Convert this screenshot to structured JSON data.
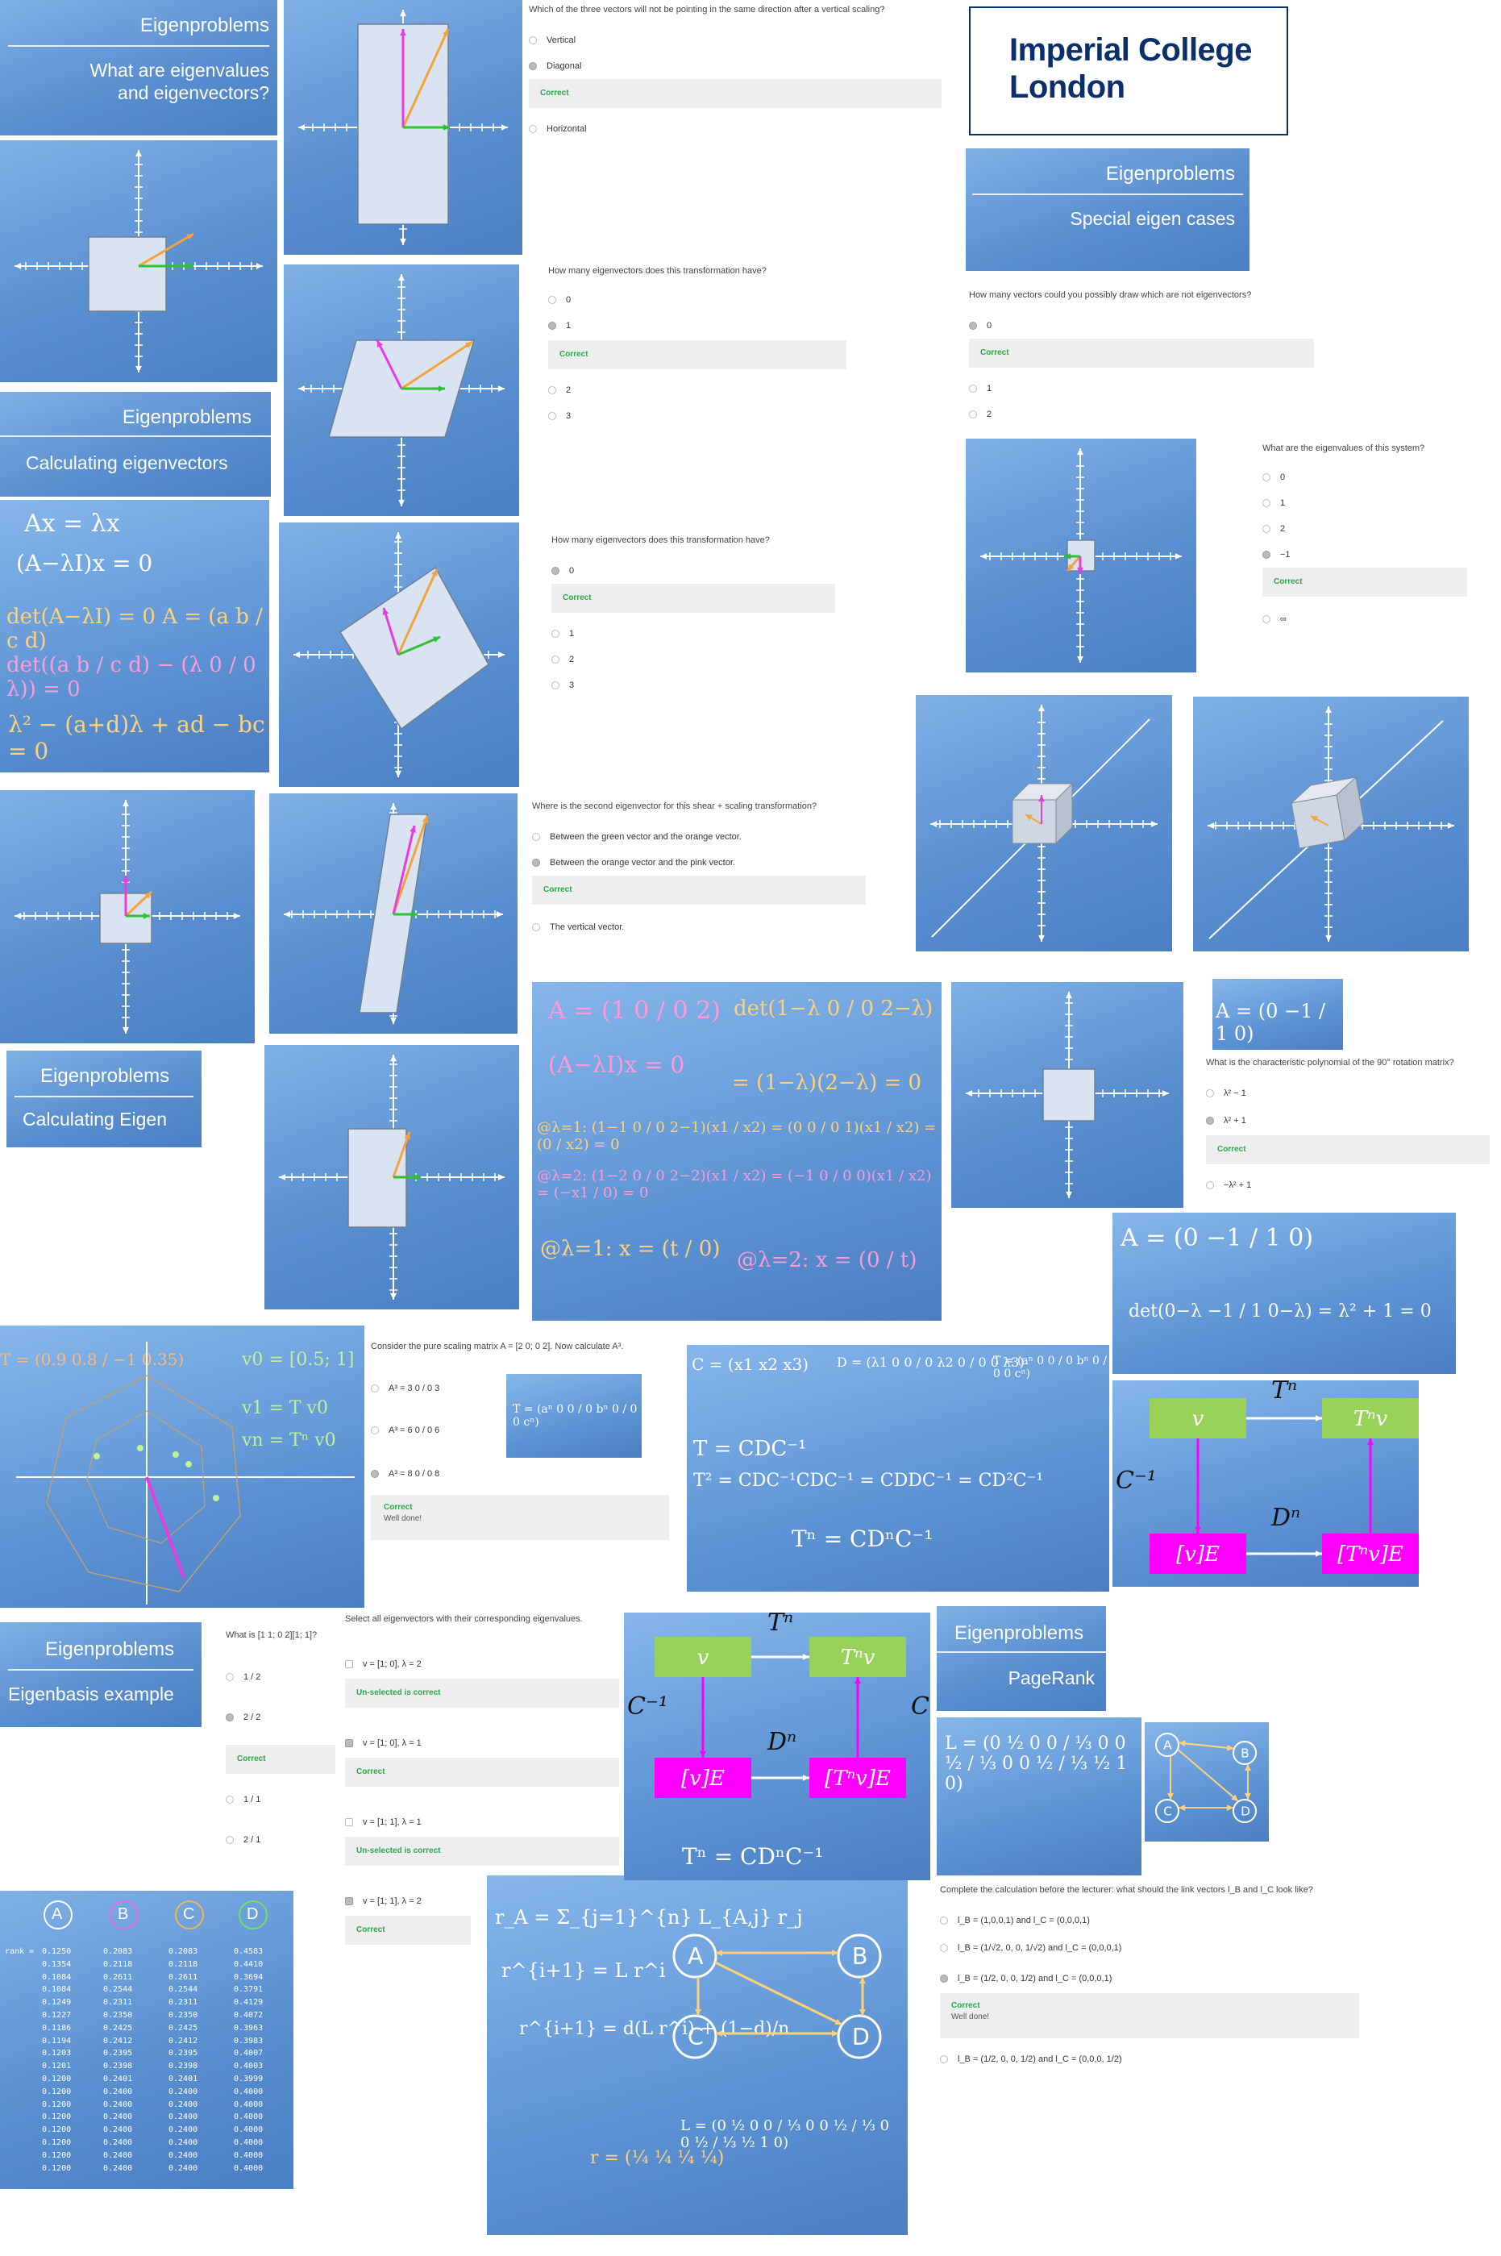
{
  "logo": {
    "line1": "Imperial College",
    "line2": "London"
  },
  "title_cards": [
    {
      "heading": "Eigenproblems",
      "subtitle_line1": "What are eigenvalues",
      "subtitle_line2": "and eigenvectors?"
    },
    {
      "heading": "Eigenproblems",
      "subtitle_line1": "Calculating eigenvectors"
    },
    {
      "heading": "Eigenproblems",
      "subtitle_line1": "Calculating Eigen"
    },
    {
      "heading": "Eigenproblems",
      "subtitle_line1": "Eigenbasis example"
    },
    {
      "heading": "Eigenproblems",
      "subtitle_line1": "Special eigen cases"
    },
    {
      "heading": "Eigenproblems",
      "subtitle_line1": "PageRank"
    }
  ],
  "quizzes": {
    "q1": {
      "question": "Which of the three vectors will not be pointing in the same direction after a vertical scaling?",
      "options": [
        "Vertical",
        "Diagonal",
        "Horizontal"
      ],
      "feedback": "Correct"
    },
    "q2": {
      "question": "How many eigenvectors does this transformation have?",
      "options": [
        "0",
        "1",
        "2",
        "3"
      ],
      "feedback": "Correct"
    },
    "q3": {
      "question": "How many eigenvectors does this transformation have?",
      "options": [
        "0",
        "1",
        "2",
        "3"
      ],
      "feedback": "Correct"
    },
    "q4": {
      "question": "Where is the second eigenvector for this shear + scaling transformation?",
      "options": [
        "Between the green vector and the orange vector.",
        "Between the orange vector and the pink vector.",
        "The vertical vector."
      ],
      "feedback": "Correct"
    },
    "q5": {
      "question": "How many vectors could you possibly draw which are not eigenvectors?",
      "options": [
        "0",
        "1",
        "2"
      ],
      "feedback": "Correct"
    },
    "q6": {
      "question": "What are the eigenvalues of this system?",
      "options": [
        "0",
        "1",
        "2",
        "−1",
        "∞"
      ],
      "feedback": "Correct"
    },
    "q7": {
      "question": "What is the characteristic polynomial of the 90° rotation matrix?",
      "options": [
        "λ² − 1",
        "λ² + 1",
        "−λ² + 1"
      ],
      "feedback": "Correct"
    },
    "q8": {
      "question": "Consider the pure scaling matrix A = [2 0; 0 2]. Now calculate A³.",
      "prefix": "A³ =",
      "options": [
        "3 0 / 0 3",
        "6 0 / 0 6",
        "8 0 / 0 8"
      ],
      "feedback": "Correct",
      "feedback_msg": "Well done!"
    },
    "q9": {
      "question": "What is [1 1; 0 2][1; 1]?",
      "options": [
        "1 / 2",
        "2 / 2",
        "1 / 1",
        "2 / 1"
      ],
      "feedback": "Correct"
    },
    "q10": {
      "question": "Select all eigenvectors with their corresponding eigenvalues.",
      "options": [
        "v = [1; 0], λ = 2",
        "v = [1; 0], λ = 1",
        "v = [1; 1], λ = 1",
        "v = [1; 1], λ = 2"
      ],
      "feedbacks": [
        "Un-selected is correct",
        "Correct",
        "Un-selected is correct",
        "Correct"
      ]
    },
    "q11": {
      "question": "Complete the calculation before the lecturer: what should the link vectors l_B and l_C look like?",
      "options": [
        "l_B = (1,0,0,1) and l_C = (0,0,0,1)",
        "l_B = (1/√2, 0, 0, 1/√2) and l_C = (0,0,0,1)",
        "l_B = (1/2, 0, 0, 1/2) and l_C = (0,0,0,1)",
        "l_B = (1/2, 0, 0, 1/2) and l_C = (0,0,0, 1/2)"
      ],
      "feedback": "Correct",
      "feedback_msg": "Well done!"
    }
  },
  "boards": {
    "b1": {
      "lines": [
        "Ax = λx",
        "(A−λI)x = 0",
        "det(A−λI) = 0   A = (a b / c d)",
        "det((a b / c d) − (λ 0 / 0 λ)) = 0",
        "λ² − (a+d)λ + ad − bc = 0"
      ]
    },
    "b2": {
      "lines": [
        "A = (1 0 / 0 2)",
        "det(1−λ 0 / 0 2−λ)",
        "(A−λI)x = 0",
        "= (1−λ)(2−λ) = 0",
        "@λ=1: (1−1 0 / 0 2−1)(x1 / x2) = (0 0 / 0 1)(x1 / x2) = (0 / x2) = 0",
        "@λ=2: (1−2 0 / 0 2−2)(x1 / x2) = (−1 0 / 0 0)(x1 / x2) = (−x1 / 0) = 0",
        "@λ=1: x = (t / 0)",
        "@λ=2: x = (0 / t)"
      ]
    },
    "b3": {
      "lines": [
        "A = (0 −1 / 1 0)"
      ]
    },
    "b4": {
      "lines": [
        "A = (0 −1 / 1 0)",
        "det(0−λ −1 / 1 0−λ) = λ² + 1 = 0"
      ]
    },
    "b5": {
      "lines": [
        "T = (0.9 0.8 / −1 0.35)",
        "v0 = [0.5; 1]",
        "v1 = T v0",
        "vn = Tⁿ v0"
      ]
    },
    "b6": {
      "lines": [
        "T = (aⁿ 0 0 / 0 bⁿ 0 / 0 0 cⁿ)"
      ]
    },
    "b7": {
      "lines": [
        "C = (x1 x2 x3)",
        "D = (λ1 0 0 / 0 λ2 0 / 0 0 λ3)",
        "T = (aⁿ 0 0 / 0 bⁿ 0 / 0 0 cⁿ)",
        "T = CDC⁻¹",
        "T² = CDC⁻¹CDC⁻¹ = CDDC⁻¹ = CD²C⁻¹",
        "Tⁿ = CDⁿC⁻¹"
      ]
    },
    "b10": {
      "lines": [
        "L = (0 ½ 0 0 / ⅓ 0 0 ½ / ⅓ 0 0 ½ / ⅓ ½ 1 0)"
      ]
    },
    "b12": {
      "lines": [
        "r_A = Σ_{j=1}^{n} L_{A,j} r_j",
        "r^{i+1} = L r^i",
        "r^{i+1} = d(L r^i) + (1−d)/n",
        "r = (¼ ¼ ¼ ¼)",
        "L = (0 ½ 0 0 / ⅓ 0 0 ½ / ⅓ 0 0 ½ / ⅓ ½ 1 0)"
      ]
    }
  },
  "diagram": {
    "v": "v",
    "Tn": "Tⁿ",
    "Tnv": "Tⁿv",
    "Cinv": "C⁻¹",
    "C": "C",
    "Dn": "Dⁿ",
    "vE": "[v]E",
    "TnvE": "[Tⁿv]E",
    "formula": "Tⁿ = CDⁿC⁻¹"
  },
  "graph_nodes": [
    "A",
    "B",
    "C",
    "D"
  ],
  "pagerank_table": {
    "row_label": "rank =",
    "headers": [
      "A",
      "B",
      "C",
      "D"
    ],
    "rows": [
      [
        "0.1250",
        "0.2083",
        "0.2083",
        "0.4583"
      ],
      [
        "0.1354",
        "0.2118",
        "0.2118",
        "0.4410"
      ],
      [
        "0.1084",
        "0.2611",
        "0.2611",
        "0.3694"
      ],
      [
        "0.1084",
        "0.2544",
        "0.2544",
        "0.3791"
      ],
      [
        "0.1249",
        "0.2311",
        "0.2311",
        "0.4129"
      ],
      [
        "0.1227",
        "0.2350",
        "0.2350",
        "0.4072"
      ],
      [
        "0.1186",
        "0.2425",
        "0.2425",
        "0.3963"
      ],
      [
        "0.1194",
        "0.2412",
        "0.2412",
        "0.3983"
      ],
      [
        "0.1203",
        "0.2395",
        "0.2395",
        "0.4007"
      ],
      [
        "0.1201",
        "0.2398",
        "0.2398",
        "0.4003"
      ],
      [
        "0.1200",
        "0.2401",
        "0.2401",
        "0.3999"
      ],
      [
        "0.1200",
        "0.2400",
        "0.2400",
        "0.4000"
      ],
      [
        "0.1200",
        "0.2400",
        "0.2400",
        "0.4000"
      ],
      [
        "0.1200",
        "0.2400",
        "0.2400",
        "0.4000"
      ],
      [
        "0.1200",
        "0.2400",
        "0.2400",
        "0.4000"
      ],
      [
        "0.1200",
        "0.2400",
        "0.2400",
        "0.4000"
      ],
      [
        "0.1200",
        "0.2400",
        "0.2400",
        "0.4000"
      ],
      [
        "0.1200",
        "0.2400",
        "0.2400",
        "0.4000"
      ]
    ]
  },
  "colors": {
    "bg_blue": "#5d93d4",
    "vec_orange": "#f5a23a",
    "vec_green": "#2ec233",
    "vec_pink": "#e83ce0",
    "correct_green": "#2aa84a",
    "box_green": "#99d25a",
    "box_magenta": "#ff00ff",
    "logo_navy": "#0b2f6b"
  }
}
